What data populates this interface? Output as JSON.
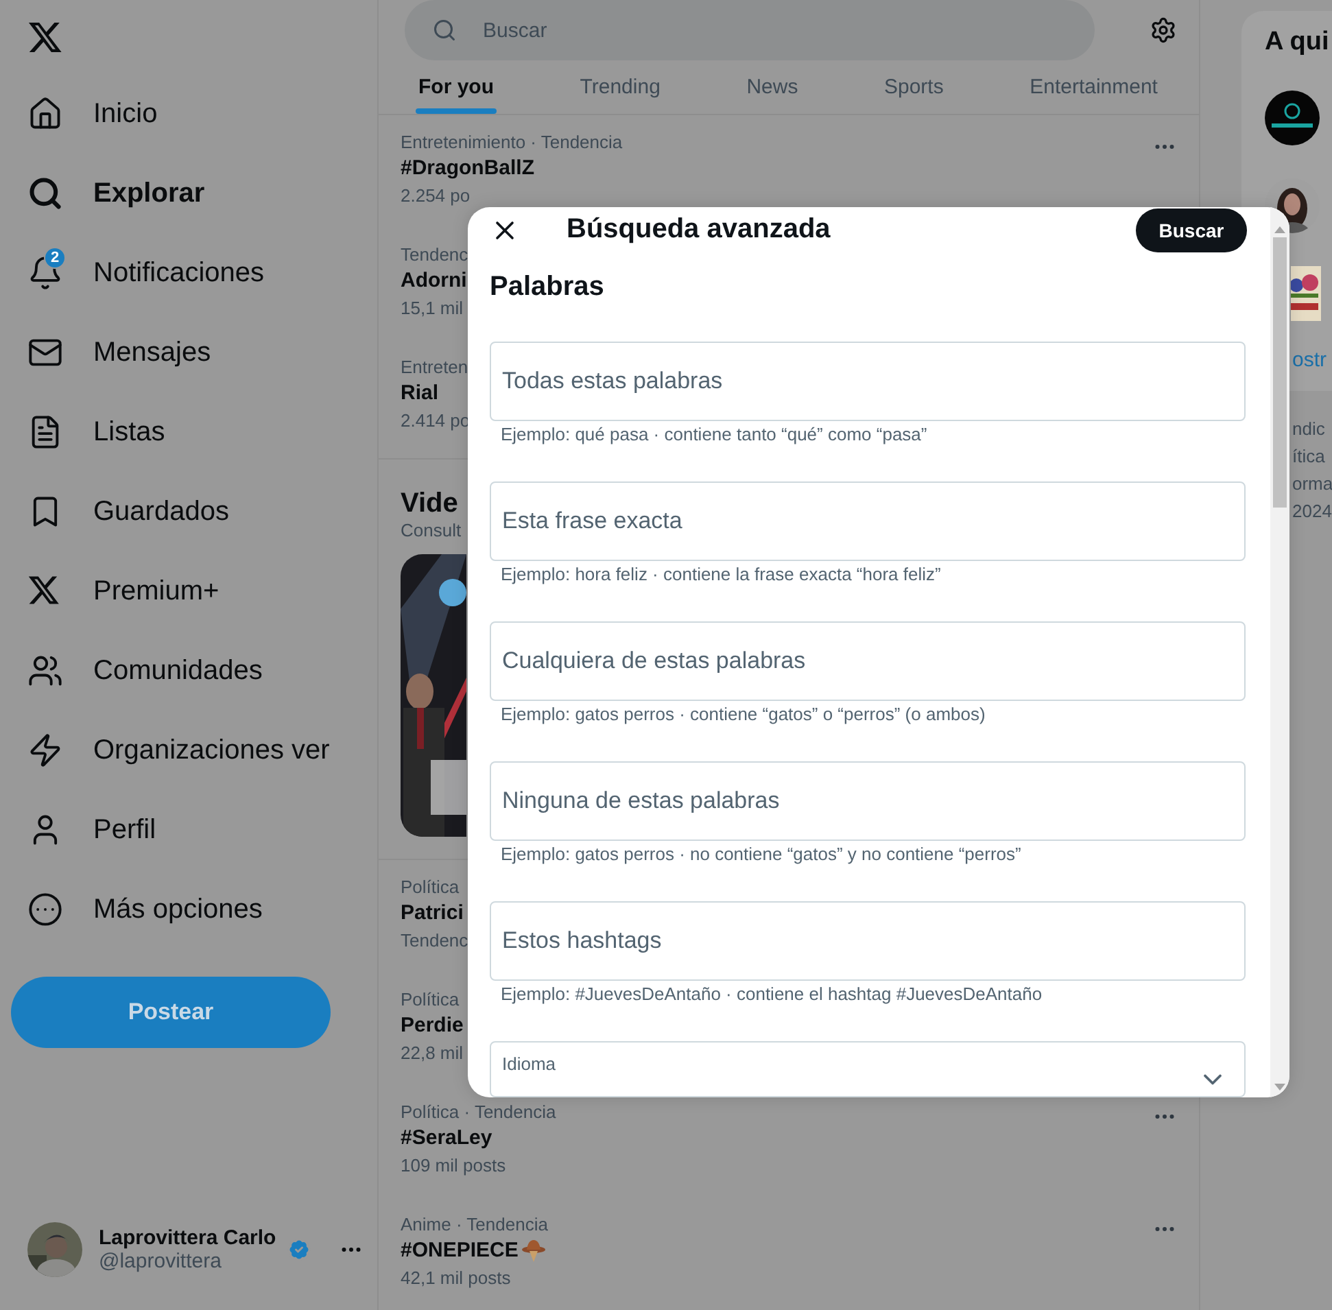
{
  "sidebar": {
    "items": [
      {
        "label": "Inicio",
        "selected": false
      },
      {
        "label": "Explorar",
        "selected": true
      },
      {
        "label": "Notificaciones",
        "selected": false,
        "badge": "2"
      },
      {
        "label": "Mensajes",
        "selected": false
      },
      {
        "label": "Listas",
        "selected": false
      },
      {
        "label": "Guardados",
        "selected": false
      },
      {
        "label": "Premium+",
        "selected": false
      },
      {
        "label": "Comunidades",
        "selected": false
      },
      {
        "label": "Organizaciones ver",
        "selected": false
      },
      {
        "label": "Perfil",
        "selected": false
      },
      {
        "label": "Más opciones",
        "selected": false
      }
    ],
    "post_button": "Postear",
    "account": {
      "name": "Laprovittera Carlo",
      "handle": "@laprovittera",
      "verified": true
    }
  },
  "search": {
    "placeholder": "Buscar"
  },
  "tabs": [
    {
      "label": "For you",
      "selected": true
    },
    {
      "label": "Trending",
      "selected": false
    },
    {
      "label": "News",
      "selected": false
    },
    {
      "label": "Sports",
      "selected": false
    },
    {
      "label": "Entertainment",
      "selected": false
    }
  ],
  "trends_top": [
    {
      "category": "Entretenimiento · Tendencia",
      "title": "#DragonBallZ",
      "count": "2.254 po",
      "menu": true
    },
    {
      "category": "Tendenc",
      "title": "Adorni",
      "count": "15,1 mil",
      "menu": false
    },
    {
      "category": "Entreten",
      "title": "Rial",
      "count": "2.414 po",
      "menu": false
    }
  ],
  "video_section": {
    "title": "Vide",
    "subtitle": "Consult"
  },
  "trends_bottom": [
    {
      "category": "Política",
      "title": "Patrici",
      "count": "Tendenc",
      "menu": false
    },
    {
      "category": "Política",
      "title": "Perdie",
      "count": "22,8 mil",
      "menu": false
    },
    {
      "category": "Política · Tendencia",
      "title": "#SeraLey",
      "count": "109 mil posts",
      "menu": true
    },
    {
      "category": "Anime · Tendencia",
      "title": "#ONEPIECE",
      "count": "42,1 mil posts",
      "menu": true,
      "hashflag": true
    }
  ],
  "right_panel": {
    "title": "A qui",
    "show_more": "ostr",
    "footer": [
      "ndic",
      "ítica",
      "orma",
      "2024"
    ]
  },
  "dialog": {
    "title": "Búsqueda avanzada",
    "submit": "Buscar",
    "section": "Palabras",
    "fields": [
      {
        "placeholder": "Todas estas palabras",
        "hint": "Ejemplo: qué pasa · contiene tanto “qué” como “pasa”"
      },
      {
        "placeholder": "Esta frase exacta",
        "hint": "Ejemplo: hora feliz · contiene la frase exacta “hora feliz”"
      },
      {
        "placeholder": "Cualquiera de estas palabras",
        "hint": "Ejemplo: gatos perros · contiene “gatos” o “perros” (o ambos)"
      },
      {
        "placeholder": "Ninguna de estas palabras",
        "hint": "Ejemplo: gatos perros · no contiene “gatos” y no contiene “perros”"
      },
      {
        "placeholder": "Estos hashtags",
        "hint": "Ejemplo: #JuevesDeAntaño · contiene el hashtag #JuevesDeAntaño"
      }
    ],
    "select": {
      "label": "Idioma"
    }
  }
}
